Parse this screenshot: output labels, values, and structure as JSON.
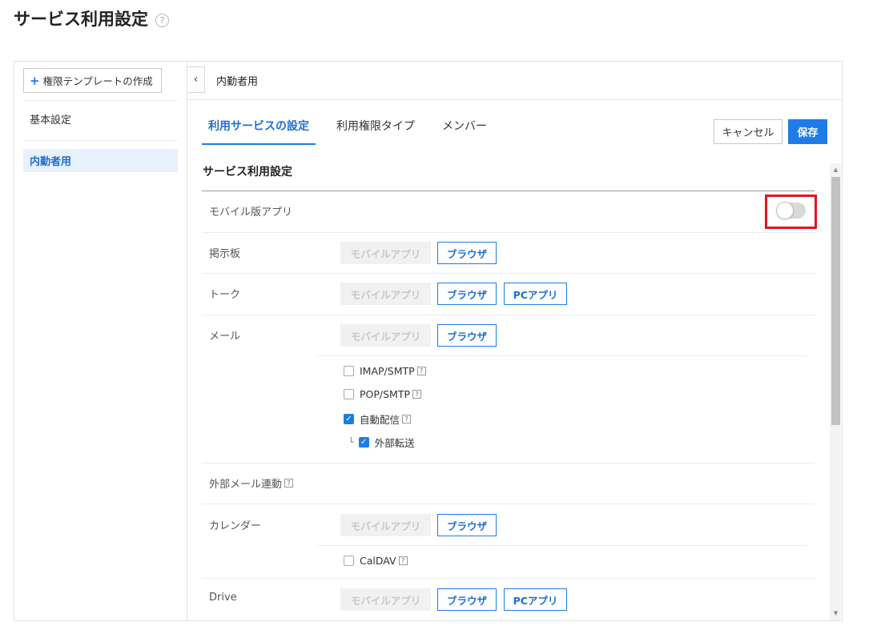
{
  "page": {
    "title": "サービス利用設定",
    "help_glyph": "?"
  },
  "sidebar": {
    "create_button": "権限テンプレートの作成",
    "items": [
      {
        "label": "基本設定",
        "active": false
      },
      {
        "label": "内勤者用",
        "active": true
      }
    ]
  },
  "main": {
    "collapse_glyph": "‹",
    "title": "内勤者用",
    "tabs": [
      {
        "label": "利用サービスの設定",
        "active": true
      },
      {
        "label": "利用権限タイプ",
        "active": false
      },
      {
        "label": "メンバー",
        "active": false
      }
    ],
    "cancel_label": "キャンセル",
    "save_label": "保存",
    "section_title": "サービス利用設定"
  },
  "services": {
    "mobile_app": {
      "label": "モバイル版アプリ",
      "enabled": false
    },
    "board": {
      "label": "掲示板",
      "mobile": "モバイルアプリ",
      "browser": "ブラウザ"
    },
    "talk": {
      "label": "トーク",
      "mobile": "モバイルアプリ",
      "browser": "ブラウザ",
      "pc": "PCアプリ"
    },
    "mail": {
      "label": "メール",
      "mobile": "モバイルアプリ",
      "browser": "ブラウザ",
      "options": [
        {
          "label": "IMAP/SMTP",
          "checked": false
        },
        {
          "label": "POP/SMTP",
          "checked": false
        },
        {
          "label": "自動配信",
          "checked": true
        },
        {
          "label": "外部転送",
          "checked": true,
          "tree_glyph": "└"
        }
      ]
    },
    "external_mail": {
      "label": "外部メール連動"
    },
    "calendar": {
      "label": "カレンダー",
      "mobile": "モバイルアプリ",
      "browser": "ブラウザ",
      "option": {
        "label": "CalDAV",
        "checked": false
      }
    },
    "drive": {
      "label": "Drive",
      "mobile": "モバイルアプリ",
      "browser": "ブラウザ",
      "pc": "PCアプリ"
    }
  },
  "colors": {
    "accent": "#1e7ce8",
    "highlight": "#e3161b"
  }
}
